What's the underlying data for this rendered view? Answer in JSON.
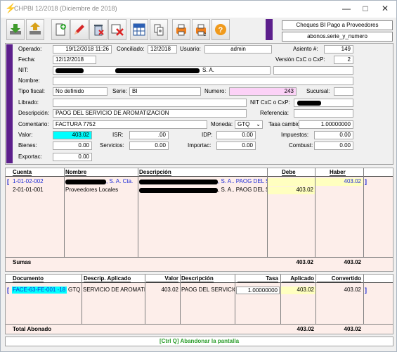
{
  "window": {
    "title": "CHPBI 12/2018 (Diciembre de 2018)"
  },
  "header": {
    "doc_type": "Cheques BI Pago a Proveedores",
    "table_ref": "abonos.serie_y_numero"
  },
  "form": {
    "operado_label": "Operado:",
    "operado": "19/12/2018 11:26",
    "conciliado_label": "Conciliado:",
    "conciliado": "12/2018",
    "usuario_label": "Usuario:",
    "usuario": "admin",
    "asiento_label": "Asiento #:",
    "asiento": "149",
    "fecha_label": "Fecha:",
    "fecha": "12/12/2018",
    "version_label": "Versión CxC o CxP:",
    "version": "2",
    "nit_label": "NIT:",
    "nit_suffix": "S. A.",
    "nombre_label": "Nombre:",
    "tipo_fiscal_label": "Tipo fiscal:",
    "tipo_fiscal": "No definido",
    "serie_label": "Serie:",
    "serie": "BI",
    "numero_label": "Numero:",
    "numero": "243",
    "sucursal_label": "Sucursal:",
    "librado_label": "Librado:",
    "nit_cxc_label": "NIT CxC o CxP:",
    "descripcion_label": "Descripción:",
    "descripcion": "PAOG DEL SERVICIO DE AROMATIZACION",
    "referencia_label": "Referencia:",
    "comentario_label": "Comentario:",
    "comentario": "FACTURA 7752",
    "moneda_label": "Moneda:",
    "moneda": "GTQ",
    "tasa_label": "Tasa cambio:",
    "tasa": "1.00000000",
    "valor_label": "Valor:",
    "valor": "403.02",
    "isr_label": "ISR:",
    "isr": ".00",
    "idp_label": "IDP:",
    "idp": "0.00",
    "impuestos_label": "Impuestos:",
    "impuestos": "0.00",
    "bienes_label": "Bienes:",
    "bienes": "0.00",
    "servicios_label": "Servicios:",
    "servicios": "0.00",
    "importac_label": "Importac:",
    "importac": "0.00",
    "combust_label": "Combust:",
    "combust": "0.00",
    "exportac_label": "Exportac:",
    "exportac": "0.00"
  },
  "accounts": {
    "headers": {
      "cuenta": "Cuenta",
      "nombre": "Nombre",
      "descripcion": "Descripción",
      "debe": "Debe",
      "haber": "Haber"
    },
    "rows": [
      {
        "cuenta": "1-01-02-002",
        "nombre_suffix": ", S. A. Cta.",
        "desc_suffix": ", S. A.. PAOG DEL S",
        "debe": "",
        "haber": "403.02"
      },
      {
        "cuenta": "2-01-01-001",
        "nombre": "Proveedores Locales",
        "desc_suffix": ", S. A.. PAOG DEL S",
        "debe": "403.02",
        "haber": ""
      }
    ],
    "sumas_label": "Sumas",
    "sumas_debe": "403.02",
    "sumas_haber": "403.02"
  },
  "applied": {
    "headers": {
      "documento": "Documento",
      "descrip": "Descrip. Aplicado",
      "valor": "Valor",
      "descripcion": "Descripción",
      "tasa": "Tasa",
      "aplicado": "Aplicado",
      "convertido": "Convertido"
    },
    "rows": [
      {
        "documento": "FACE-63-FE-001 -18",
        "moneda": "GTQ",
        "descrip": "SERVICIO DE AROMATI.",
        "valor": "403.02",
        "descripcion": "PAOG DEL SERVICIO",
        "tasa": "1.00000000",
        "aplicado": "403.02",
        "convertido": "403.02"
      }
    ],
    "total_label": "Total Abonado",
    "total_aplicado": "403.02",
    "total_convertido": "403.02"
  },
  "status": {
    "hint": "[Ctrl Q] Abandonar la pantalla"
  },
  "colors": {
    "accent_purple": "#5c1f8c",
    "numero_bg": "#fcd2f7",
    "valor_bg": "#00ffff",
    "yellow_cell": "#ffffc0",
    "status_green": "#2a9d2a"
  }
}
